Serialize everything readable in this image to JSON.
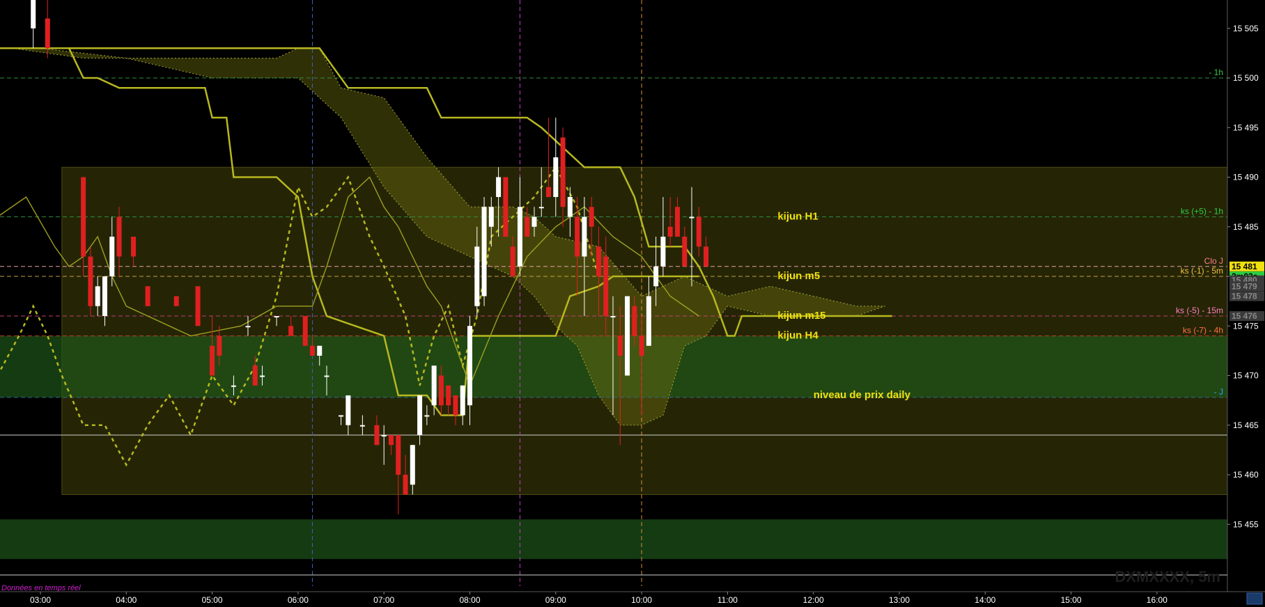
{
  "chart_data": {
    "type": "candlestick",
    "instrument_watermark": "DXMXXXX, 5m",
    "footer_text": "Données en temps réel",
    "x_ticks": [
      "03:00",
      "04:00",
      "05:00",
      "06:00",
      "07:00",
      "08:00",
      "09:00",
      "10:00",
      "11:00",
      "12:00",
      "13:00",
      "14:00",
      "15:00",
      "16:00"
    ],
    "y_ticks": [
      "15 505",
      "15 500",
      "15 495",
      "15 490",
      "15 485",
      "15 480",
      "15 475",
      "15 470",
      "15 465",
      "15 460",
      "15 455"
    ],
    "y_tick_values": [
      15505,
      15500,
      15495,
      15490,
      15485,
      15480,
      15475,
      15470,
      15465,
      15460,
      15455
    ],
    "ylim": [
      15452.5,
      15507.5
    ],
    "price_badges": [
      {
        "text": "15 481",
        "value": 15481,
        "bg": "#f0e010",
        "fg": "#000000"
      },
      {
        "text": "2m02s",
        "value": 15480,
        "bg": "#2ecc40",
        "fg": "#000000"
      },
      {
        "text": "15 480",
        "value": 15479.6,
        "bg": "#3a3a3a",
        "fg": "#888888"
      },
      {
        "text": "15 479",
        "value": 15479,
        "bg": "#3a3a3a",
        "fg": "#888888"
      },
      {
        "text": "15 478",
        "value": 15478,
        "bg": "#3a3a3a",
        "fg": "#888888"
      },
      {
        "text": "15 476",
        "value": 15476,
        "bg": "#3a3a3a",
        "fg": "#888888"
      }
    ],
    "horizontal_lines": [
      {
        "label": "- 1h",
        "value": 15500,
        "color": "#2e8b3e",
        "text_color": "#2ecc40",
        "style": "dash"
      },
      {
        "label": "ks (+5) - 1h",
        "value": 15486,
        "color": "#2e8b3e",
        "text_color": "#2ecc40",
        "style": "dash"
      },
      {
        "label": "Clo J",
        "value": 15481,
        "color": "#e8a0a0",
        "text_color": "#ff8080",
        "style": "dash"
      },
      {
        "label": "ks (-1) - 5m",
        "value": 15480,
        "color": "#c8a040",
        "text_color": "#f0c040",
        "style": "dash"
      },
      {
        "label": "ks (-5) - 15m",
        "value": 15476,
        "color": "#c04070",
        "text_color": "#ff80c0",
        "style": "dash"
      },
      {
        "label": "ks (-7) - 4h",
        "value": 15474,
        "color": "#c04020",
        "text_color": "#ff7040",
        "style": "dash"
      },
      {
        "label": "- J",
        "value": 15467.8,
        "color": "#2e6b8b",
        "text_color": "#30a0ff",
        "style": "dash"
      },
      {
        "label": "",
        "value": 15464,
        "color": "#cfcfcf",
        "text_color": "#cfcfcf",
        "style": "solid"
      }
    ],
    "annotations": [
      {
        "text": "kijun H1",
        "value": 15486,
        "time": "11:35"
      },
      {
        "text": "kijun m5",
        "value": 15480,
        "time": "11:35"
      },
      {
        "text": "kijun m15",
        "value": 15476,
        "time": "11:35"
      },
      {
        "text": "kijun H4",
        "value": 15474,
        "time": "11:35"
      },
      {
        "text": "niveau de prix daily",
        "value": 15468,
        "time": "12:00"
      }
    ],
    "zones": [
      {
        "from_time": "03:15",
        "to_time": "end",
        "low": 15458,
        "high": 15491,
        "color": "#6b6b10",
        "opacity": 0.35
      },
      {
        "from_time": "start",
        "to_time": "end",
        "low": 15467.8,
        "high": 15474,
        "color": "#1e5a1a",
        "opacity": 0.65
      },
      {
        "from_time": "start",
        "to_time": "end",
        "low": 15451.5,
        "high": 15455.5,
        "color": "#1e5a1a",
        "opacity": 0.65
      }
    ],
    "vertical_lines": [
      {
        "time": "06:10",
        "color": "#4060c0"
      },
      {
        "time": "08:35",
        "color": "#c040c0"
      },
      {
        "time": "10:00",
        "color": "#d09040"
      }
    ],
    "candles": [
      {
        "t": "02:55",
        "o": 15505,
        "h": 15508,
        "l": 15503,
        "c": 15508
      },
      {
        "t": "03:05",
        "o": 15506,
        "h": 15508,
        "l": 15502,
        "c": 15503
      },
      {
        "t": "03:30",
        "o": 15490,
        "h": 15490,
        "l": 15480,
        "c": 15482
      },
      {
        "t": "03:35",
        "o": 15482,
        "h": 15483,
        "l": 15476,
        "c": 15477
      },
      {
        "t": "03:40",
        "o": 15477,
        "h": 15480,
        "l": 15476,
        "c": 15479
      },
      {
        "t": "03:45",
        "o": 15476,
        "h": 15480,
        "l": 15475,
        "c": 15480
      },
      {
        "t": "03:50",
        "o": 15480,
        "h": 15486,
        "l": 15479,
        "c": 15484
      },
      {
        "t": "03:55",
        "o": 15486,
        "h": 15487,
        "l": 15480,
        "c": 15482
      },
      {
        "t": "04:05",
        "o": 15484,
        "h": 15484,
        "l": 15481,
        "c": 15482
      },
      {
        "t": "04:15",
        "o": 15479,
        "h": 15479,
        "l": 15477,
        "c": 15477
      },
      {
        "t": "04:35",
        "o": 15478,
        "h": 15478,
        "l": 15477,
        "c": 15477
      },
      {
        "t": "04:50",
        "o": 15479,
        "h": 15479,
        "l": 15475,
        "c": 15475
      },
      {
        "t": "05:00",
        "o": 15473,
        "h": 15476,
        "l": 15470,
        "c": 15470
      },
      {
        "t": "05:05",
        "o": 15474,
        "h": 15475,
        "l": 15471,
        "c": 15472
      },
      {
        "t": "05:15",
        "o": 15469,
        "h": 15470,
        "l": 15468,
        "c": 15469
      },
      {
        "t": "05:25",
        "o": 15475,
        "h": 15476,
        "l": 15474,
        "c": 15475
      },
      {
        "t": "05:30",
        "o": 15471,
        "h": 15472,
        "l": 15469,
        "c": 15469
      },
      {
        "t": "05:35",
        "o": 15470,
        "h": 15471,
        "l": 15469,
        "c": 15470
      },
      {
        "t": "05:45",
        "o": 15476,
        "h": 15476,
        "l": 15475,
        "c": 15476
      },
      {
        "t": "05:55",
        "o": 15475,
        "h": 15476,
        "l": 15474,
        "c": 15474
      },
      {
        "t": "06:05",
        "o": 15476,
        "h": 15476,
        "l": 15473,
        "c": 15473
      },
      {
        "t": "06:10",
        "o": 15473,
        "h": 15474,
        "l": 15472,
        "c": 15472
      },
      {
        "t": "06:15",
        "o": 15472,
        "h": 15473,
        "l": 15471,
        "c": 15473
      },
      {
        "t": "06:20",
        "o": 15470,
        "h": 15471,
        "l": 15468,
        "c": 15470
      },
      {
        "t": "06:30",
        "o": 15466,
        "h": 15466,
        "l": 15465,
        "c": 15466
      },
      {
        "t": "06:35",
        "o": 15465,
        "h": 15468,
        "l": 15464,
        "c": 15468
      },
      {
        "t": "06:45",
        "o": 15465,
        "h": 15466,
        "l": 15464,
        "c": 15465
      },
      {
        "t": "06:55",
        "o": 15465,
        "h": 15466,
        "l": 15463,
        "c": 15463
      },
      {
        "t": "07:00",
        "o": 15464,
        "h": 15465,
        "l": 15461,
        "c": 15464
      },
      {
        "t": "07:05",
        "o": 15464,
        "h": 15464,
        "l": 15462,
        "c": 15463
      },
      {
        "t": "07:10",
        "o": 15464,
        "h": 15464,
        "l": 15456,
        "c": 15460
      },
      {
        "t": "07:15",
        "o": 15460,
        "h": 15462,
        "l": 15458,
        "c": 15458
      },
      {
        "t": "07:20",
        "o": 15459,
        "h": 15463,
        "l": 15458,
        "c": 15463
      },
      {
        "t": "07:25",
        "o": 15464,
        "h": 15468,
        "l": 15463,
        "c": 15468
      },
      {
        "t": "07:30",
        "o": 15466,
        "h": 15467,
        "l": 15465,
        "c": 15466
      },
      {
        "t": "07:35",
        "o": 15467,
        "h": 15471,
        "l": 15466,
        "c": 15471
      },
      {
        "t": "07:40",
        "o": 15470,
        "h": 15471,
        "l": 15466,
        "c": 15467
      },
      {
        "t": "07:45",
        "o": 15469,
        "h": 15469,
        "l": 15466,
        "c": 15467
      },
      {
        "t": "07:50",
        "o": 15468,
        "h": 15468,
        "l": 15465,
        "c": 15466
      },
      {
        "t": "07:55",
        "o": 15466,
        "h": 15469,
        "l": 15465,
        "c": 15469
      },
      {
        "t": "08:00",
        "o": 15467,
        "h": 15476,
        "l": 15465,
        "c": 15475
      },
      {
        "t": "08:05",
        "o": 15477,
        "h": 15485,
        "l": 15476,
        "c": 15483
      },
      {
        "t": "08:10",
        "o": 15478,
        "h": 15488,
        "l": 15477,
        "c": 15487
      },
      {
        "t": "08:15",
        "o": 15485,
        "h": 15488,
        "l": 15483,
        "c": 15487
      },
      {
        "t": "08:20",
        "o": 15488,
        "h": 15491,
        "l": 15484,
        "c": 15490
      },
      {
        "t": "08:25",
        "o": 15490,
        "h": 15490,
        "l": 15484,
        "c": 15484
      },
      {
        "t": "08:30",
        "o": 15483,
        "h": 15484,
        "l": 15480,
        "c": 15480
      },
      {
        "t": "08:35",
        "o": 15481,
        "h": 15490,
        "l": 15480,
        "c": 15487
      },
      {
        "t": "08:40",
        "o": 15486,
        "h": 15487,
        "l": 15484,
        "c": 15484
      },
      {
        "t": "08:45",
        "o": 15485,
        "h": 15487,
        "l": 15484,
        "c": 15486
      },
      {
        "t": "08:50",
        "o": 15487,
        "h": 15491,
        "l": 15486,
        "c": 15487
      },
      {
        "t": "08:55",
        "o": 15489,
        "h": 15496,
        "l": 15488,
        "c": 15488
      },
      {
        "t": "09:00",
        "o": 15488,
        "h": 15496,
        "l": 15486,
        "c": 15492
      },
      {
        "t": "09:05",
        "o": 15494,
        "h": 15495,
        "l": 15485,
        "c": 15487
      },
      {
        "t": "09:10",
        "o": 15486,
        "h": 15489,
        "l": 15484,
        "c": 15488
      },
      {
        "t": "09:15",
        "o": 15486,
        "h": 15488,
        "l": 15478,
        "c": 15482
      },
      {
        "t": "09:20",
        "o": 15482,
        "h": 15488,
        "l": 15476,
        "c": 15486
      },
      {
        "t": "09:25",
        "o": 15487,
        "h": 15488,
        "l": 15482,
        "c": 15485
      },
      {
        "t": "09:30",
        "o": 15483,
        "h": 15485,
        "l": 15476,
        "c": 15480
      },
      {
        "t": "09:35",
        "o": 15482,
        "h": 15484,
        "l": 15474,
        "c": 15476
      },
      {
        "t": "09:40",
        "o": 15476,
        "h": 15478,
        "l": 15466,
        "c": 15476
      },
      {
        "t": "09:45",
        "o": 15474,
        "h": 15477,
        "l": 15463,
        "c": 15472
      },
      {
        "t": "09:50",
        "o": 15470,
        "h": 15478,
        "l": 15470,
        "c": 15478
      },
      {
        "t": "09:55",
        "o": 15477,
        "h": 15478,
        "l": 15473,
        "c": 15474
      },
      {
        "t": "10:00",
        "o": 15474,
        "h": 15476,
        "l": 15466,
        "c": 15472
      },
      {
        "t": "10:05",
        "o": 15473,
        "h": 15480,
        "l": 15473,
        "c": 15478
      },
      {
        "t": "10:10",
        "o": 15479,
        "h": 15484,
        "l": 15477,
        "c": 15481
      },
      {
        "t": "10:15",
        "o": 15481,
        "h": 15488,
        "l": 15480,
        "c": 15484
      },
      {
        "t": "10:20",
        "o": 15485,
        "h": 15488,
        "l": 15483,
        "c": 15484
      },
      {
        "t": "10:25",
        "o": 15487,
        "h": 15488,
        "l": 15484,
        "c": 15484
      },
      {
        "t": "10:30",
        "o": 15484,
        "h": 15485,
        "l": 15481,
        "c": 15481
      },
      {
        "t": "10:35",
        "o": 15486,
        "h": 15489,
        "l": 15479,
        "c": 15486
      },
      {
        "t": "10:40",
        "o": 15486,
        "h": 15487,
        "l": 15482,
        "c": 15483
      },
      {
        "t": "10:45",
        "o": 15483,
        "h": 15484,
        "l": 15481,
        "c": 15481
      }
    ]
  }
}
